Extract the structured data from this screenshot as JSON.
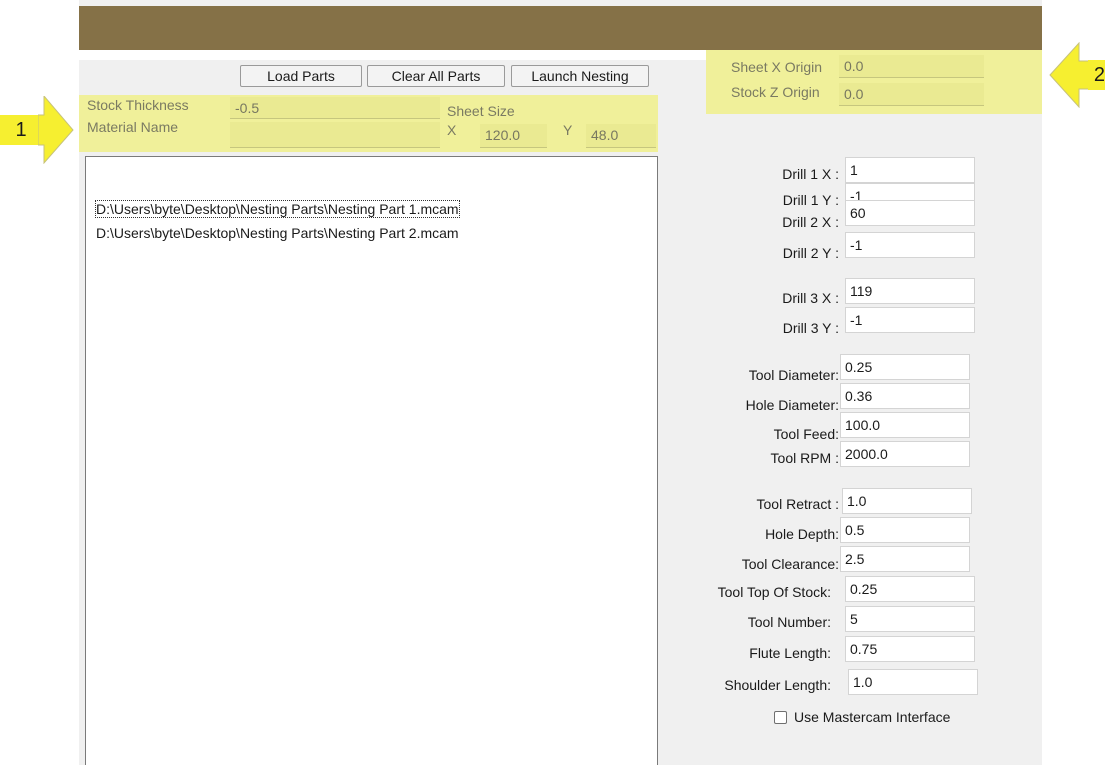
{
  "toolbar": {
    "load_parts_label": "Load Parts",
    "clear_all_parts_label": "Clear All Parts",
    "launch_nesting_label": "Launch Nesting"
  },
  "stock": {
    "stock_thickness_label": "Stock Thickness",
    "stock_thickness_value": "-0.5",
    "material_name_label": "Material Name",
    "material_name_value": "",
    "sheet_size_label": "Sheet Size",
    "x_label": "X",
    "x_value": "120.0",
    "y_label": "Y",
    "y_value": "48.0"
  },
  "origins": {
    "sheet_x_origin_label": "Sheet X Origin",
    "sheet_x_origin_value": "0.0",
    "stock_z_origin_label": "Stock Z Origin",
    "stock_z_origin_value": "0.0"
  },
  "parts_list": [
    "D:\\Users\\byte\\Desktop\\Nesting Parts\\Nesting Part 1.mcam",
    "D:\\Users\\byte\\Desktop\\Nesting Parts\\Nesting Part 2.mcam"
  ],
  "params": [
    {
      "label": "Drill 1 X :",
      "value": "1"
    },
    {
      "label": "Drill 1 Y :",
      "value": "-1"
    },
    {
      "label": "Drill 2 X :",
      "value": "60"
    },
    {
      "label": "Drill 2 Y :",
      "value": "-1"
    },
    {
      "label": "Drill 3 X :",
      "value": "119"
    },
    {
      "label": "Drill 3 Y :",
      "value": "-1"
    },
    {
      "label": "Tool Diameter:",
      "value": "0.25"
    },
    {
      "label": "Hole Diameter:",
      "value": "0.36"
    },
    {
      "label": "Tool Feed:",
      "value": "100.0"
    },
    {
      "label": "Tool RPM :",
      "value": "2000.0"
    },
    {
      "label": "Tool Retract :",
      "value": "1.0"
    },
    {
      "label": "Hole Depth:",
      "value": "0.5"
    },
    {
      "label": "Tool Clearance:",
      "value": "2.5"
    },
    {
      "label": "Tool Top Of Stock:",
      "value": "0.25"
    },
    {
      "label": "Tool Number:",
      "value": "5"
    },
    {
      "label": "Flute Length:",
      "value": "0.75"
    },
    {
      "label": "Shoulder Length:",
      "value": "1.0"
    }
  ],
  "use_mastercam": {
    "label": "Use Mastercam Interface",
    "checked": false
  },
  "callouts": {
    "one": "1",
    "two": "2"
  },
  "colors": {
    "titlebar": "#857147",
    "highlight": "#f0f09a",
    "callout": "#f6ef30"
  }
}
